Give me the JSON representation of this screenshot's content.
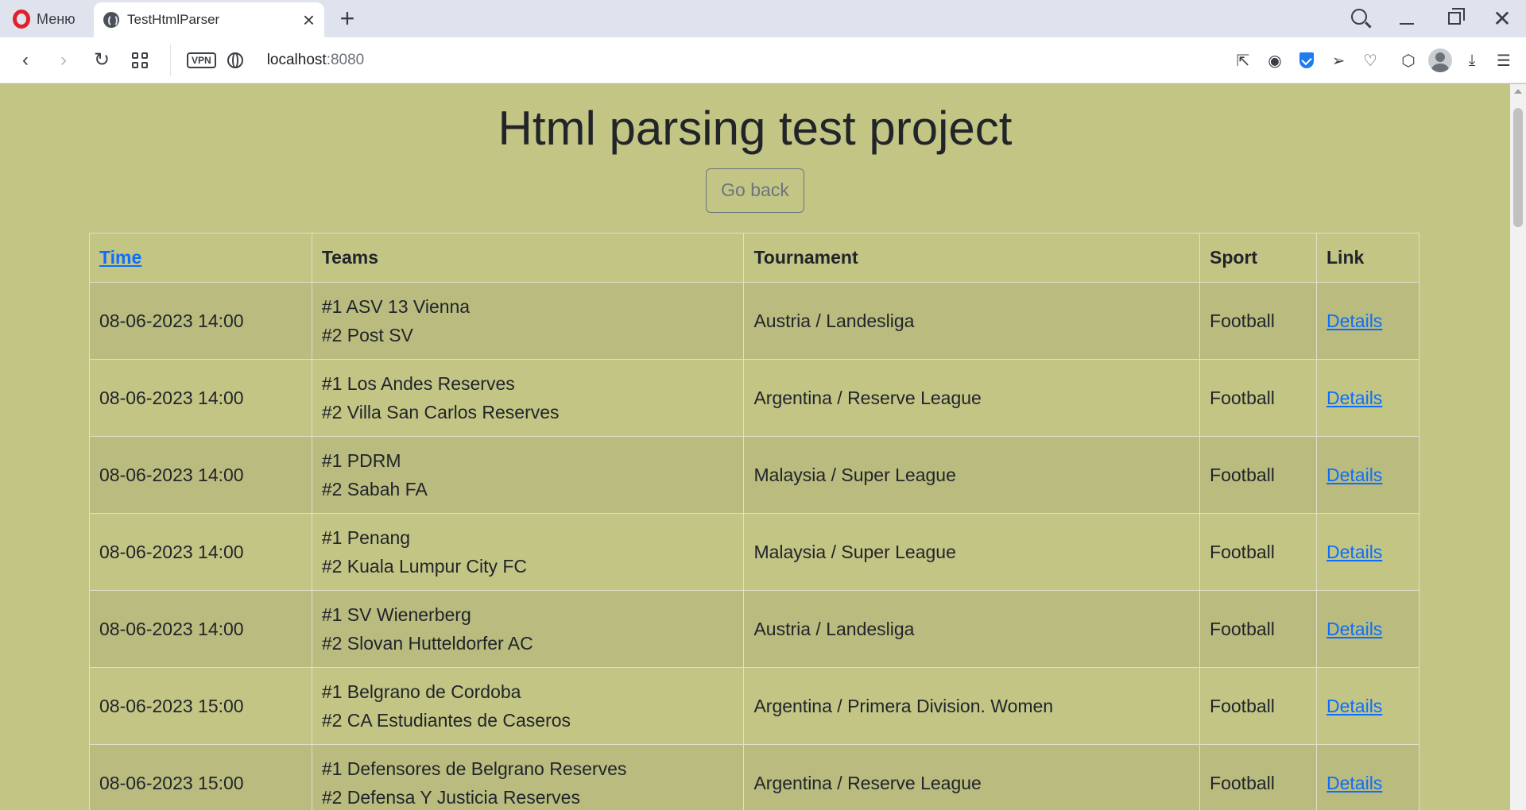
{
  "browser": {
    "menu_label": "Меню",
    "tab_title": "TestHtmlParser",
    "url_host": "localhost",
    "url_port": ":8080",
    "vpn_label": "VPN"
  },
  "page": {
    "title": "Html parsing test project",
    "back_button": "Go back"
  },
  "table": {
    "headers": {
      "time": "Time",
      "teams": "Teams",
      "tournament": "Tournament",
      "sport": "Sport",
      "link": "Link"
    },
    "rows": [
      {
        "time": "08-06-2023 14:00",
        "team1": "#1 ASV 13 Vienna",
        "team2": "#2 Post SV",
        "tournament": "Austria / Landesliga",
        "sport": "Football",
        "link": "Details"
      },
      {
        "time": "08-06-2023 14:00",
        "team1": "#1 Los Andes Reserves",
        "team2": "#2 Villa San Carlos Reserves",
        "tournament": "Argentina / Reserve League",
        "sport": "Football",
        "link": "Details"
      },
      {
        "time": "08-06-2023 14:00",
        "team1": "#1 PDRM",
        "team2": "#2 Sabah FA",
        "tournament": "Malaysia / Super League",
        "sport": "Football",
        "link": "Details"
      },
      {
        "time": "08-06-2023 14:00",
        "team1": "#1 Penang",
        "team2": "#2 Kuala Lumpur City FC",
        "tournament": "Malaysia / Super League",
        "sport": "Football",
        "link": "Details"
      },
      {
        "time": "08-06-2023 14:00",
        "team1": "#1 SV Wienerberg",
        "team2": "#2 Slovan Hutteldorfer AC",
        "tournament": "Austria / Landesliga",
        "sport": "Football",
        "link": "Details"
      },
      {
        "time": "08-06-2023 15:00",
        "team1": "#1 Belgrano de Cordoba",
        "team2": "#2 CA Estudiantes de Caseros",
        "tournament": "Argentina / Primera Division. Women",
        "sport": "Football",
        "link": "Details"
      },
      {
        "time": "08-06-2023 15:00",
        "team1": "#1 Defensores de Belgrano Reserves",
        "team2": "#2 Defensa Y Justicia Reserves",
        "tournament": "Argentina / Reserve League",
        "sport": "Football",
        "link": "Details"
      }
    ]
  },
  "colors": {
    "page_background": "#c3c585",
    "striped_row": "#b9bb7f",
    "link": "#0d6efd",
    "opera_red": "#e0202e",
    "shield_blue": "#1f7cf0"
  }
}
